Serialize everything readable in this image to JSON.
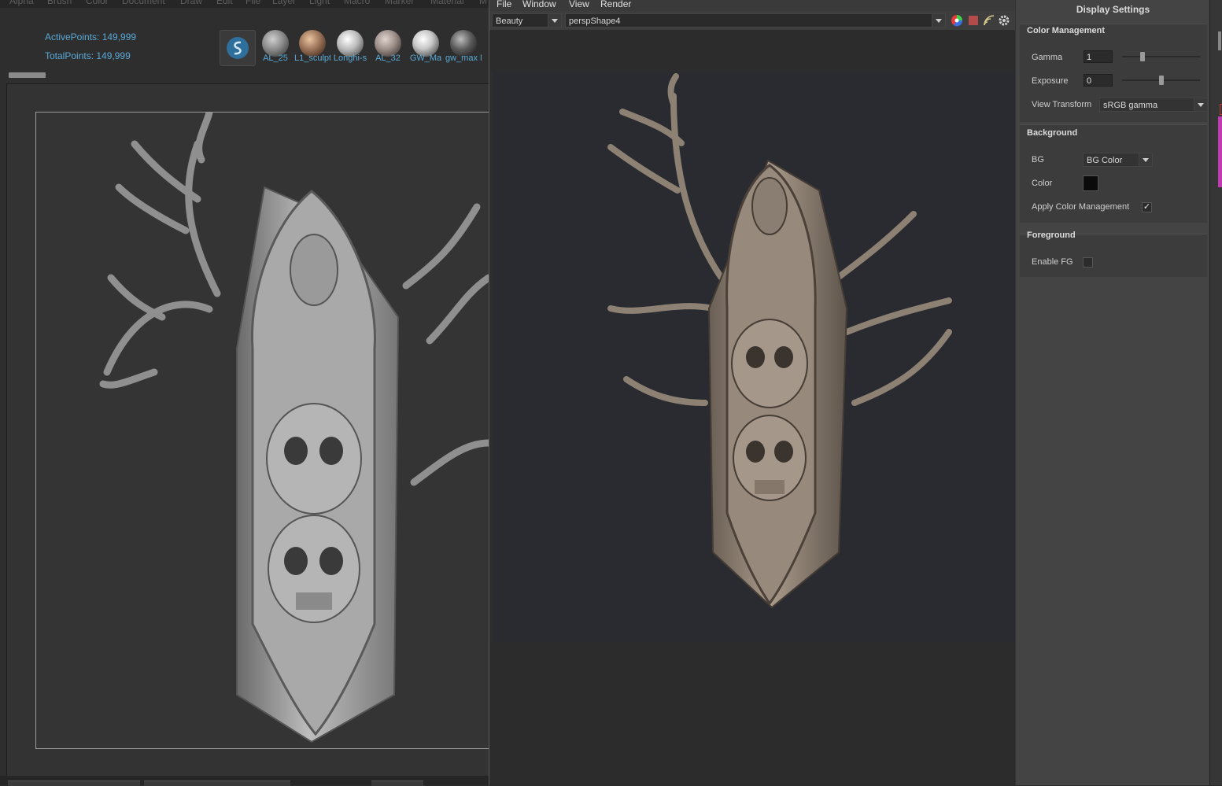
{
  "zbrush": {
    "menu": [
      "Alpha",
      "Brush",
      "Color",
      "Document",
      "Draw",
      "Edit",
      "File",
      "Layer",
      "Light",
      "Macro",
      "Marker",
      "Material",
      "M"
    ],
    "active_points": "ActivePoints: 149,999",
    "total_points": "TotalPoints: 149,999",
    "materials": [
      {
        "label": "AL_25",
        "color": "#8a8a8a"
      },
      {
        "label": "L1_sculpt",
        "color": "#9a7258"
      },
      {
        "label": "Longhi-s",
        "color": "#b9b9b9"
      },
      {
        "label": "AL_32",
        "color": "#9a8c86"
      },
      {
        "label": "GW_Ma",
        "color": "#c8c8c8"
      },
      {
        "label": "gw_max M",
        "color": "#5a5a5a"
      }
    ]
  },
  "renderview": {
    "menu": [
      "File",
      "Window",
      "View",
      "Render"
    ],
    "aov": "Beauty",
    "camera": "perspShape4"
  },
  "display_settings": {
    "title": "Display Settings",
    "color_management": {
      "header": "Color Management",
      "gamma_label": "Gamma",
      "gamma_value": "1",
      "gamma_level": 0.25,
      "exposure_label": "Exposure",
      "exposure_value": "0",
      "exposure_level": 0.5,
      "view_transform_label": "View Transform",
      "view_transform_value": "sRGB gamma"
    },
    "background": {
      "header": "Background",
      "bg_label": "BG",
      "bg_value": "BG Color",
      "color_label": "Color",
      "color_value": "#0b0b0b",
      "apply_label": "Apply Color Management",
      "apply_checked": true
    },
    "foreground": {
      "header": "Foreground",
      "enable_label": "Enable FG",
      "enable_checked": false
    }
  }
}
